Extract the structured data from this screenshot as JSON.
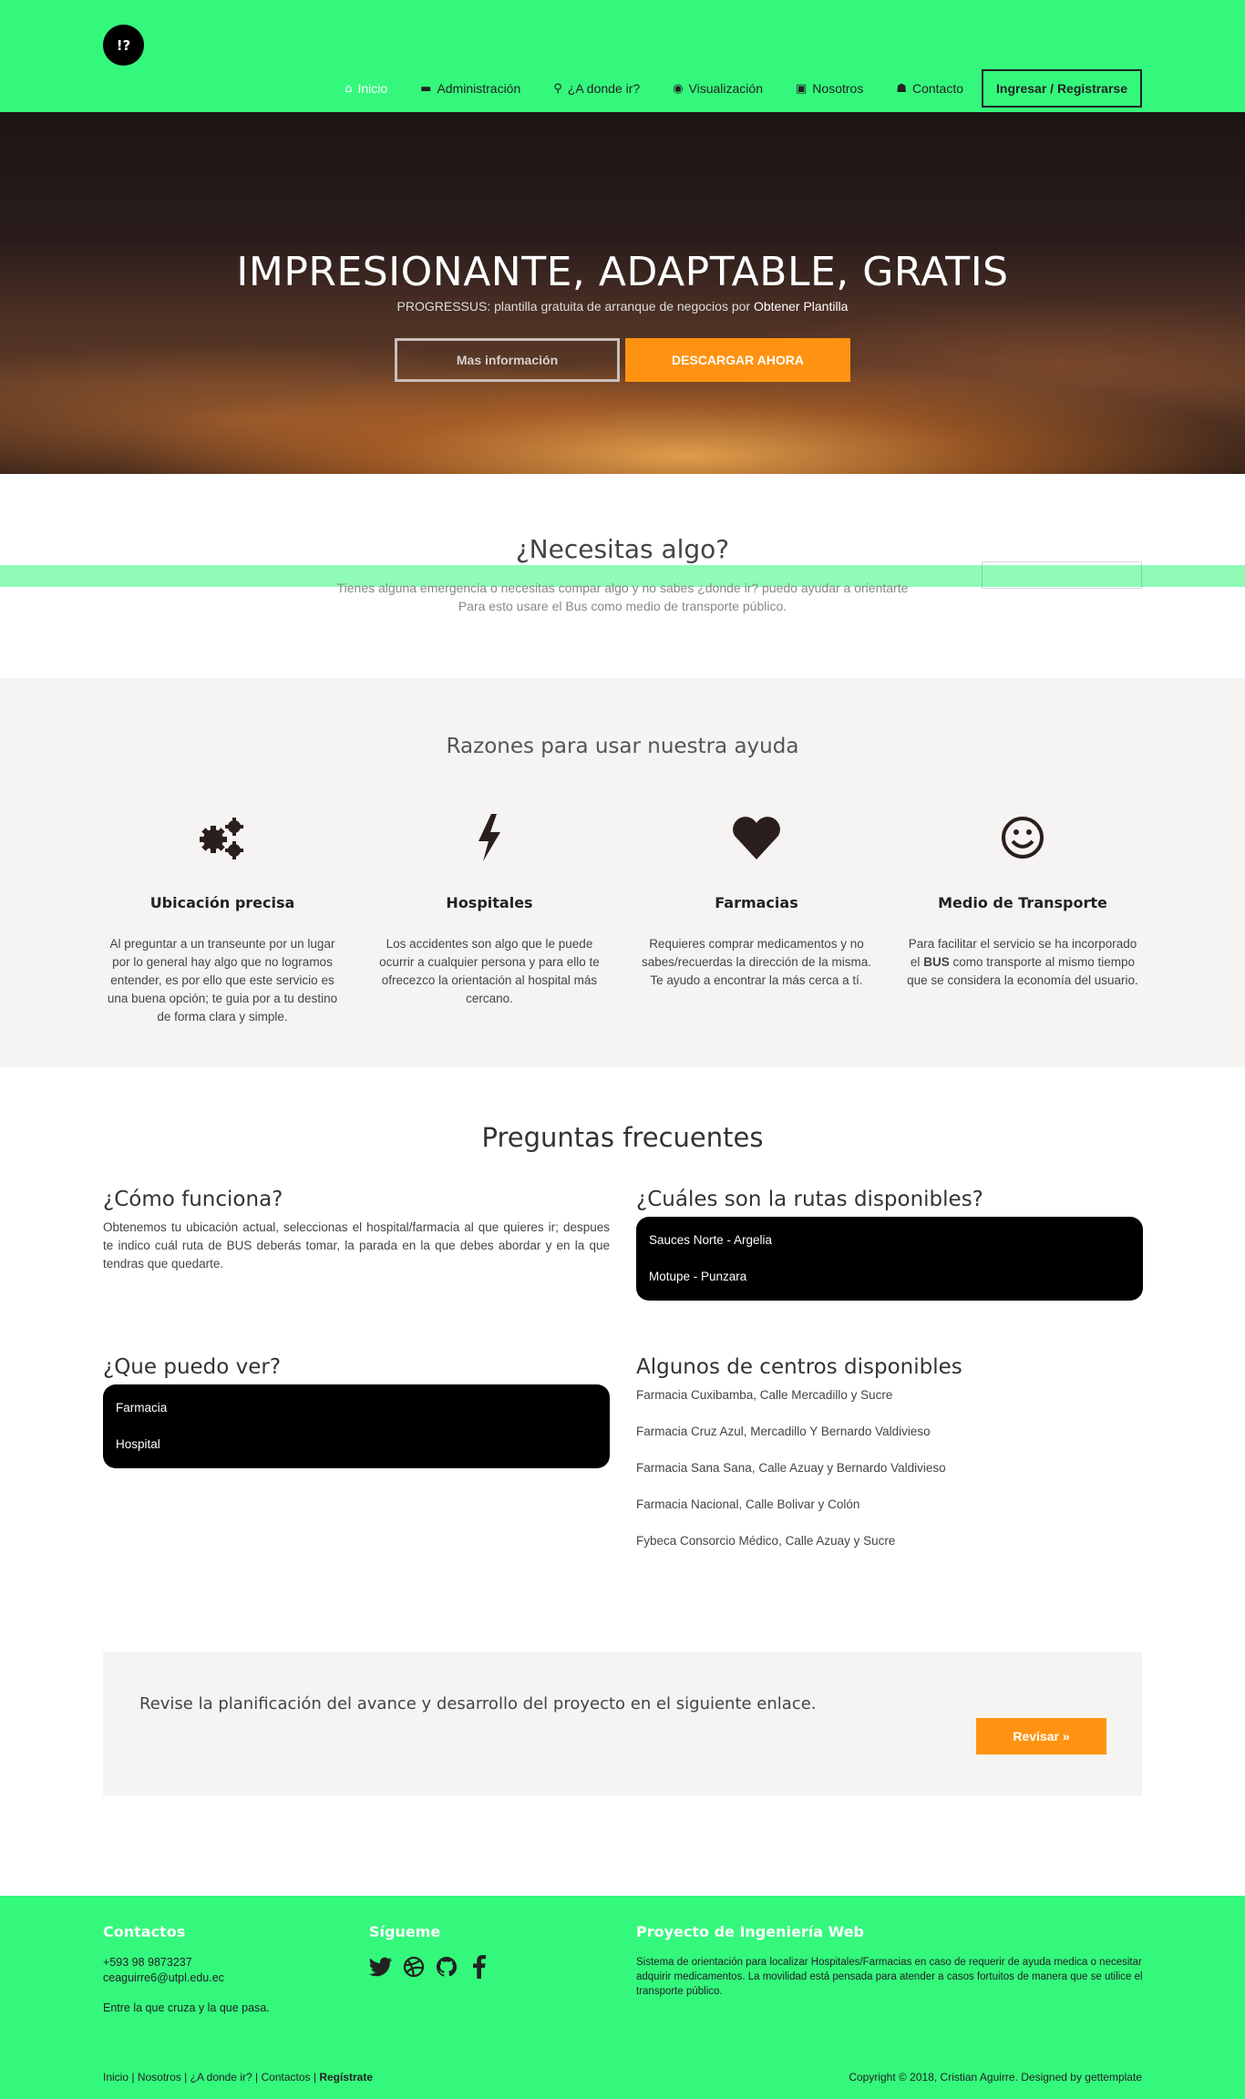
{
  "brand": {
    "logo_text": "!?"
  },
  "nav": {
    "items": [
      {
        "label": "Inicio",
        "icon": "home-icon",
        "glyph": "⌂"
      },
      {
        "label": "Administración",
        "icon": "folder-icon",
        "glyph": "▬"
      },
      {
        "label": "¿A donde ir?",
        "icon": "map-marker-icon",
        "glyph": "⚲"
      },
      {
        "label": "Visualización",
        "icon": "eye-icon",
        "glyph": "◉"
      },
      {
        "label": "Nosotros",
        "icon": "contact-book-icon",
        "glyph": "▣"
      },
      {
        "label": "Contacto",
        "icon": "user-icon",
        "glyph": "☗"
      }
    ],
    "login_label": "Ingresar / Registrarse"
  },
  "hero": {
    "title": "IMPRESIONANTE, ADAPTABLE, GRATIS",
    "subtitle": "PROGRESSUS: plantilla gratuita de arranque de negocios por",
    "subtitle_link": "Obtener Plantilla",
    "more_label": "Mas información",
    "download_label": "DESCARGAR AHORA"
  },
  "need": {
    "title": "¿Necesitas algo?",
    "line1": "Tienes alguna emergencia o necesitas compar algo y no sabes ¿donde ir? puedo ayudar a orientarte",
    "line2": "Para esto usare el Bus como medio de transporte público."
  },
  "reasons": {
    "title": "Razones para usar nuestra ayuda",
    "features": [
      {
        "icon": "gears-icon",
        "title": "Ubicación precisa",
        "text": "Al preguntar a un transeunte por un lugar por lo general hay algo que no logramos entender, es por ello que este servicio es una buena opción; te guia por a tu destino de forma clara y simple."
      },
      {
        "icon": "lightning-icon",
        "title": "Hospitales",
        "text": "Los accidentes son algo que le puede ocurrir a cualquier persona y para ello te ofrecezco la orientación al hospital más cercano."
      },
      {
        "icon": "heart-icon",
        "title": "Farmacias",
        "text": "Requieres comprar medicamentos y no sabes/recuerdas la dirección de la misma. Te ayudo a encontrar la más cerca a tí."
      },
      {
        "icon": "smile-icon",
        "title": "Medio de Transporte",
        "text_before": "Para facilitar el servicio se ha incorporado el",
        "text_bold": "BUS",
        "text_after": "como transporte al mismo tiempo que se considera la economía del usuario."
      }
    ]
  },
  "faq": {
    "title": "Preguntas frecuentes",
    "how": {
      "title": "¿Cómo funciona?",
      "text": "Obtenemos tu ubicación actual, seleccionas el hospital/farmacia al que quieres ir; despues te indico cuál ruta de BUS deberás tomar, la parada en la que debes abordar y en la que tendras que quedarte."
    },
    "routes": {
      "title": "¿Cuáles son la rutas disponibles?",
      "items": [
        "Sauces Norte - Argelia",
        "Motupe - Punzara"
      ]
    },
    "see": {
      "title": "¿Que puedo ver?",
      "items": [
        "Farmacia",
        "Hospital"
      ]
    },
    "centers": {
      "title": "Algunos de centros disponibles",
      "items": [
        "Farmacia Cuxibamba, Calle Mercadillo y Sucre",
        "Farmacia Cruz Azul, Mercadillo Y Bernardo Valdivieso",
        "Farmacia Sana Sana, Calle Azuay y Bernardo Valdivieso",
        "Farmacia Nacional, Calle Bolivar y Colón",
        "Fybeca Consorcio Médico, Calle Azuay y Sucre"
      ]
    }
  },
  "cta": {
    "text": "Revise la planificación del avance y desarrollo del proyecto en el siguiente enlace.",
    "button": "Revisar »"
  },
  "footer": {
    "contacts_title": "Contactos",
    "phone": "+593 98 9873237",
    "email": "ceaguirre6@utpl.edu.ec",
    "motto": "Entre la que cruza y la que pasa.",
    "follow_title": "Sígueme",
    "social": [
      "twitter-icon",
      "dribbble-icon",
      "github-icon",
      "facebook-icon"
    ],
    "project_title": "Proyecto de Ingeniería Web",
    "project_text": "Sistema de orientación para localizar Hospitales/Farmacias en caso de requerir de ayuda medica o necesitar adquirir medicamentos. La movilidad está pensada para atender a casos fortuitos de manera que se utilice el transporte público.",
    "links": [
      "Inicio",
      "Nosotros",
      "¿A donde ir?",
      "Contactos"
    ],
    "register": "Regístrate",
    "copyright": "Copyright © 2018, Cristian Aguirre. Designed by gettemplate"
  },
  "colors": {
    "nav_green": "#34f87c",
    "accent_orange": "#ff9311",
    "light_bg": "#f5f4f2"
  }
}
